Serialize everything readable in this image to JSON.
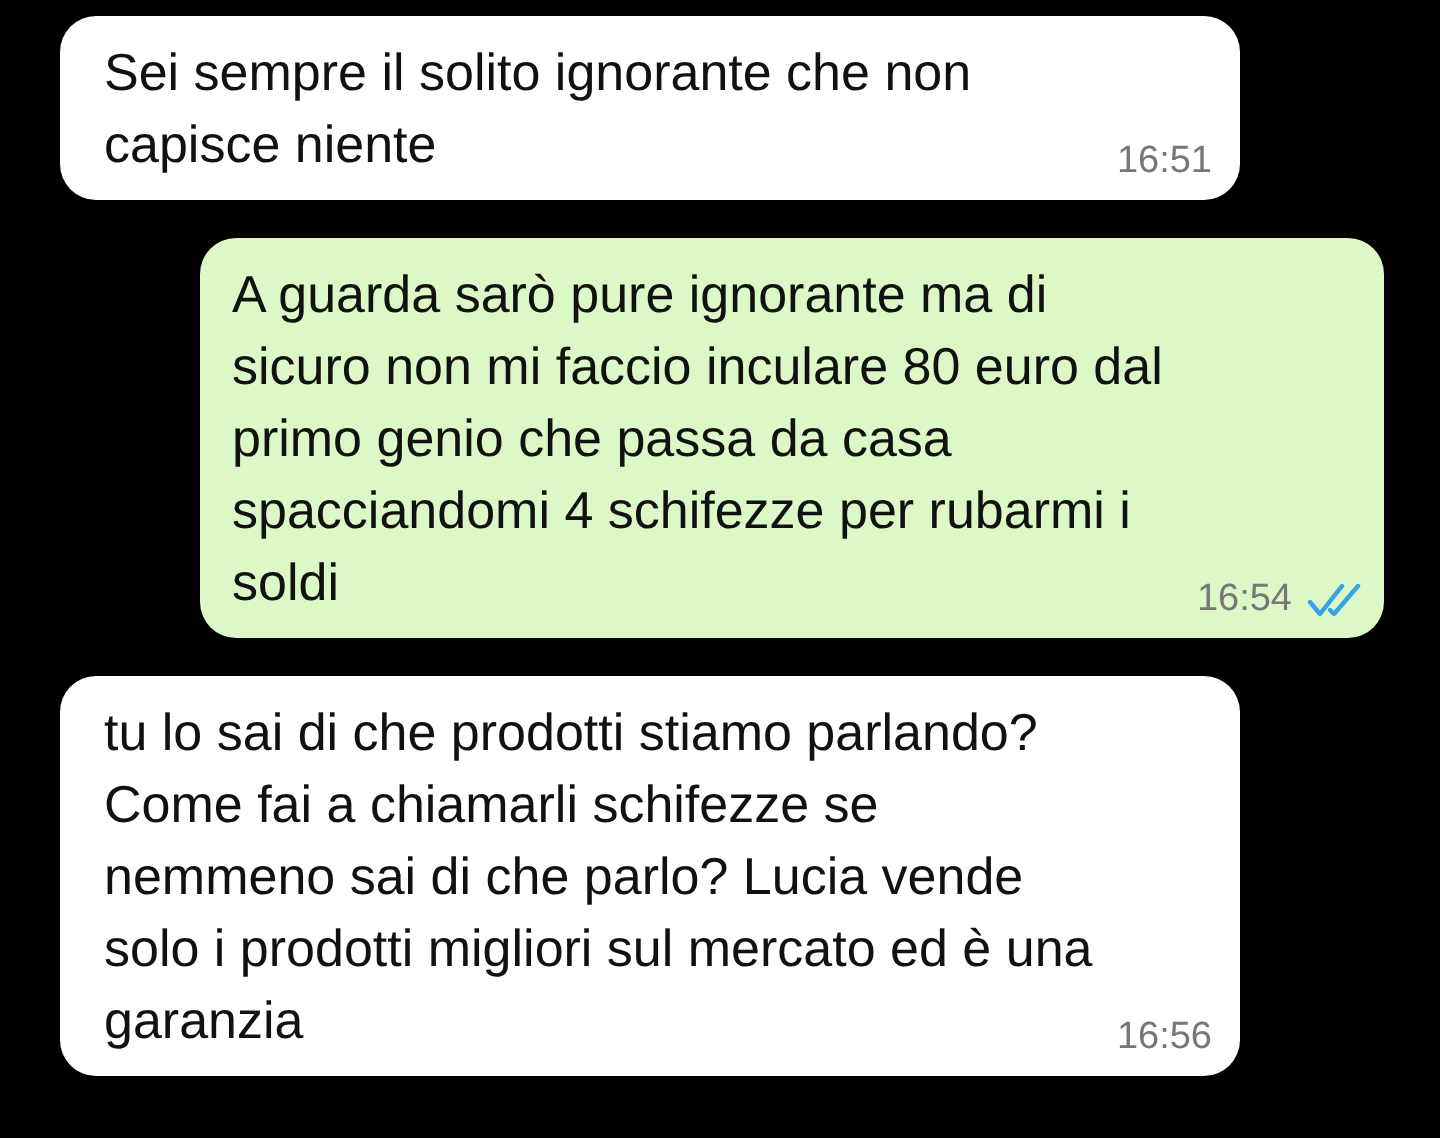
{
  "messages": [
    {
      "kind": "incoming",
      "text": "Sei sempre il solito ignorante che non capisce niente",
      "time": "16:51"
    },
    {
      "kind": "outgoing",
      "text": "A guarda sarò pure ignorante ma di sicuro non mi faccio inculare 80 euro dal primo genio che passa da casa spacciandomi 4 schifezze per rubarmi i soldi",
      "time": "16:54",
      "read": true
    },
    {
      "kind": "incoming",
      "text": "tu lo sai di che prodotti stiamo parlando? Come fai a chiamarli schifezze se nemmeno sai di che parlo? Lucia vende solo i prodotti migliori sul mercato ed è una garanzia",
      "time": "16:56"
    }
  ]
}
